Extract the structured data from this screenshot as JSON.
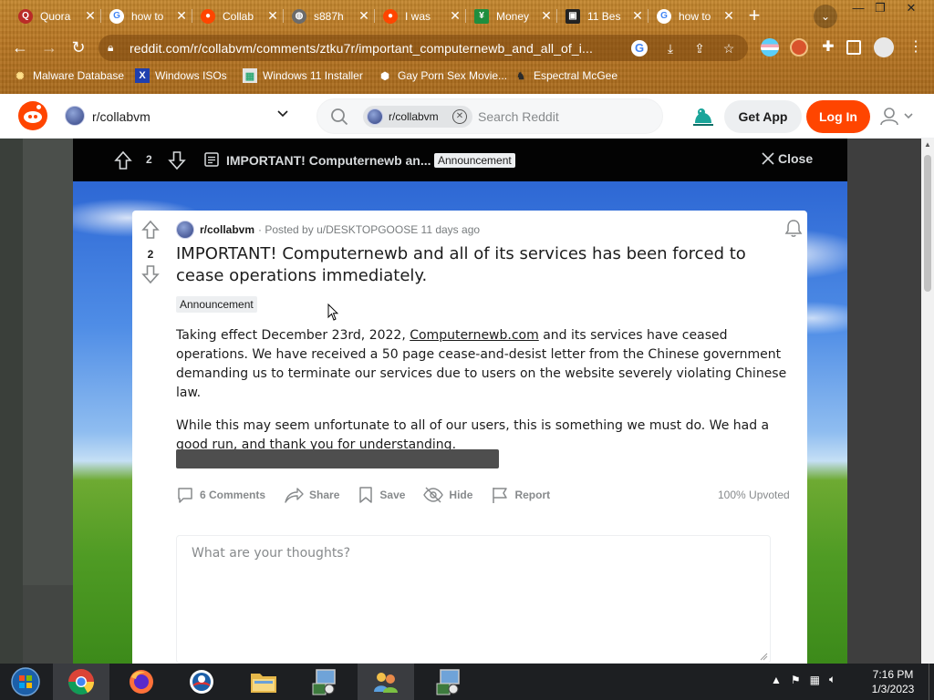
{
  "browser": {
    "tabs": [
      {
        "label": "Quora",
        "icon": "quora-icon",
        "color": "#b92b27"
      },
      {
        "label": "how to",
        "icon": "google-icon",
        "color": "#ffffff"
      },
      {
        "label": "Collab",
        "icon": "reddit-icon",
        "color": "#ff4500"
      },
      {
        "label": "s887h",
        "icon": "globe-icon",
        "color": "#6b6b6b"
      },
      {
        "label": "I was",
        "icon": "reddit-icon",
        "color": "#ff4500"
      },
      {
        "label": "Money",
        "icon": "money-icon",
        "color": "#1e8e3e"
      },
      {
        "label": "11 Bes",
        "icon": "cube-icon",
        "color": "#222222"
      },
      {
        "label": "how to",
        "icon": "google-icon",
        "color": "#ffffff"
      }
    ],
    "url": "reddit.com/r/collabvm/comments/ztku7r/important_computernewb_and_all_of_i...",
    "bookmarks": [
      {
        "label": "Malware Database",
        "icon": "malware-icon"
      },
      {
        "label": "Windows ISOs",
        "icon": "x-icon"
      },
      {
        "label": "Windows 11 Installer",
        "icon": "image-icon"
      },
      {
        "label": "Gay Porn Sex Movie...",
        "icon": "box-icon"
      },
      {
        "label": "Espectral McGee",
        "icon": "ghost-icon"
      }
    ]
  },
  "reddit_header": {
    "community": "r/collabvm",
    "search_chip": "r/collabvm",
    "search_placeholder": "Search Reddit",
    "get_app": "Get App",
    "login": "Log In"
  },
  "post_bar": {
    "votes": "2",
    "title": "IMPORTANT! Computernewb an...",
    "flair": "Announcement",
    "close": "Close"
  },
  "post": {
    "subreddit": "r/collabvm",
    "posted_by": "· Posted by u/DESKTOPGOOSE 11 days ago",
    "votes": "2",
    "title": "IMPORTANT! Computernewb and all of its services has been forced to cease operations immediately.",
    "flair": "Announcement",
    "body": {
      "p1_before": "Taking effect December 23rd, 2022, ",
      "p1_link": "Computernewb.com",
      "p1_after": " and its services have ceased operations. We have received a 50 page cease-and-desist letter from the Chinese government demanding us to terminate our services due to users on the website severely violating Chinese law.",
      "p2": "While this may seem unfortunate to all of our users, this is something we must do. We had a good run, and thank you for understanding."
    },
    "actions": {
      "comments": "6 Comments",
      "share": "Share",
      "save": "Save",
      "hide": "Hide",
      "report": "Report"
    },
    "upvoted": "100% Upvoted",
    "comment_placeholder": "What are your thoughts?"
  },
  "taskbar": {
    "time": "7:16 PM",
    "date": "1/3/2023"
  },
  "colors": {
    "reddit_orange": "#ff4500",
    "chrome_theme": "#b87622"
  }
}
